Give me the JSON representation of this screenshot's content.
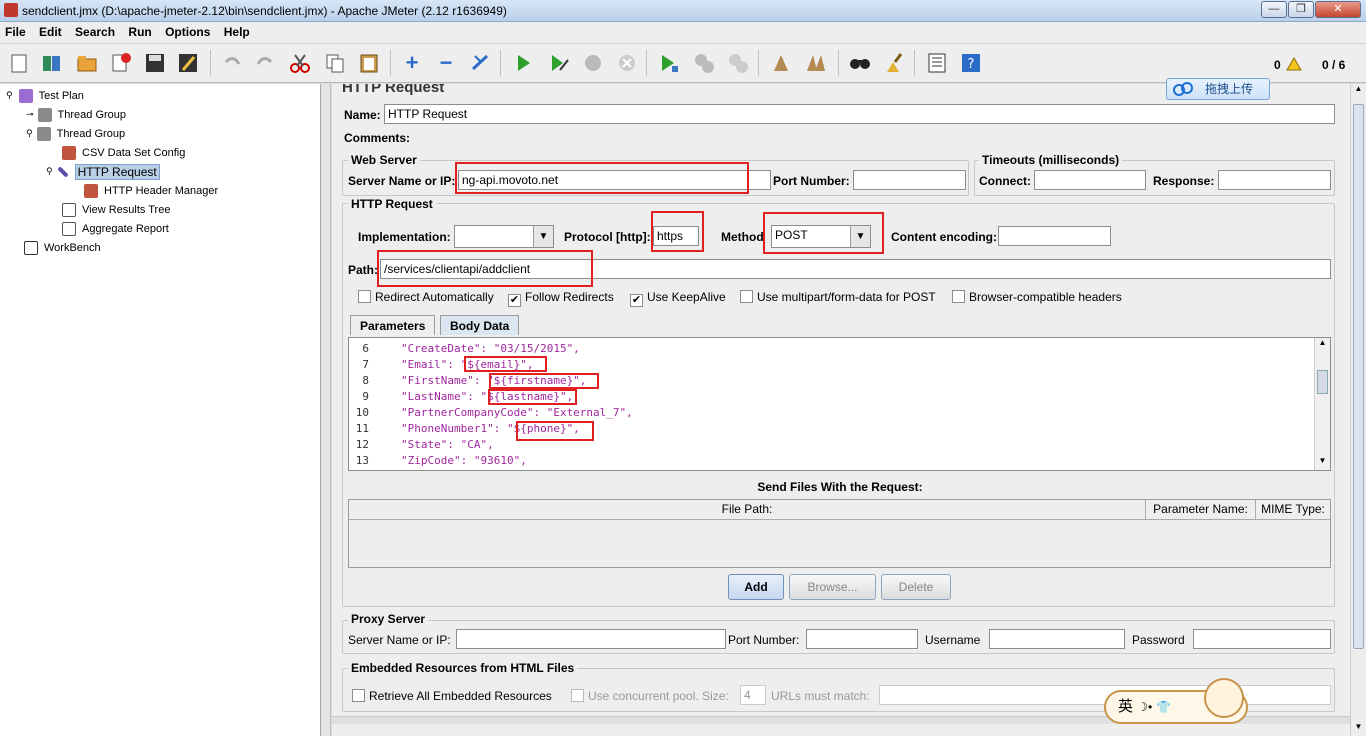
{
  "window": {
    "title": "sendclient.jmx (D:\\apache-jmeter-2.12\\bin\\sendclient.jmx) - Apache JMeter (2.12 r1636949)",
    "min": "—",
    "max": "❐",
    "close": "✕"
  },
  "menu": [
    "File",
    "Edit",
    "Search",
    "Run",
    "Options",
    "Help"
  ],
  "status": {
    "warnings": "0",
    "threads": "0 / 6"
  },
  "upload_label": "拖拽上传",
  "tree": [
    {
      "label": "Test Plan"
    },
    {
      "label": "Thread Group"
    },
    {
      "label": "Thread Group"
    },
    {
      "label": "CSV Data Set Config"
    },
    {
      "label": "HTTP Request"
    },
    {
      "label": "HTTP Header Manager"
    },
    {
      "label": "View Results Tree"
    },
    {
      "label": "Aggregate Report"
    },
    {
      "label": "WorkBench"
    }
  ],
  "panel": {
    "title": "HTTP Request",
    "name_label": "Name:",
    "name_value": "HTTP Request",
    "comments_label": "Comments:",
    "web_server_legend": "Web Server",
    "server_label": "Server Name or IP:",
    "server_value": "ng-api.movoto.net",
    "port_label": "Port Number:",
    "port_value": "",
    "timeouts_legend": "Timeouts (milliseconds)",
    "connect_label": "Connect:",
    "response_label": "Response:",
    "http_legend": "HTTP Request",
    "impl_label": "Implementation:",
    "impl_value": "",
    "protocol_label": "Protocol [http]:",
    "protocol_value": "https",
    "method_label": "Method",
    "method_value": "POST",
    "encoding_label": "Content encoding:",
    "encoding_value": "",
    "path_label": "Path:",
    "path_value": "/services/clientapi/addclient",
    "checkboxes": [
      {
        "label": "Redirect Automatically",
        "checked": false
      },
      {
        "label": "Follow Redirects",
        "checked": true
      },
      {
        "label": "Use KeepAlive",
        "checked": true
      },
      {
        "label": "Use multipart/form-data for POST",
        "checked": false
      },
      {
        "label": "Browser-compatible headers",
        "checked": false
      }
    ],
    "tabs": [
      "Parameters",
      "Body Data"
    ],
    "body_lines": [
      {
        "n": "6",
        "text": "\"CreateDate\": \"03/15/2015\","
      },
      {
        "n": "7",
        "text": "\"Email\": \"${email}\","
      },
      {
        "n": "8",
        "text": "\"FirstName\": \"${firstname}\","
      },
      {
        "n": "9",
        "text": "\"LastName\": \"${lastname}\","
      },
      {
        "n": "10",
        "text": "\"PartnerCompanyCode\": \"External_7\","
      },
      {
        "n": "11",
        "text": "\"PhoneNumber1\": \"${phone}\","
      },
      {
        "n": "12",
        "text": "\"State\": \"CA\","
      },
      {
        "n": "13",
        "text": "\"ZipCode\": \"93610\","
      }
    ],
    "files_title": "Send Files With the Request:",
    "files_cols": [
      "File Path:",
      "Parameter Name:",
      "MIME Type:"
    ],
    "add_label": "Add",
    "browse_label": "Browse...",
    "delete_label": "Delete",
    "proxy_legend": "Proxy Server",
    "proxy_server_label": "Server Name or IP:",
    "proxy_port_label": "Port Number:",
    "username_label": "Username",
    "password_label": "Password",
    "embedded_legend": "Embedded Resources from HTML Files",
    "retrieve_label": "Retrieve All Embedded Resources",
    "concurrent_label": "Use concurrent pool. Size:",
    "pool_size": "4",
    "urls_match_label": "URLs must match:"
  },
  "ime_text": "英",
  "icons": [
    "new-icon",
    "templates-icon",
    "open-icon",
    "close-icon",
    "save-icon",
    "save-as-icon",
    "undo-icon",
    "redo-icon",
    "cut-icon",
    "copy-icon",
    "paste-icon",
    "expand-icon",
    "collapse-icon",
    "toggle-icon",
    "start-icon",
    "start-no-pause-icon",
    "stop-icon",
    "shutdown-icon",
    "remote-start-icon",
    "remote-stop-icon",
    "remote-exit-icon",
    "clear-icon",
    "clear-all-icon",
    "search-icon",
    "reset-search-icon",
    "function-helper-icon",
    "help-icon"
  ]
}
